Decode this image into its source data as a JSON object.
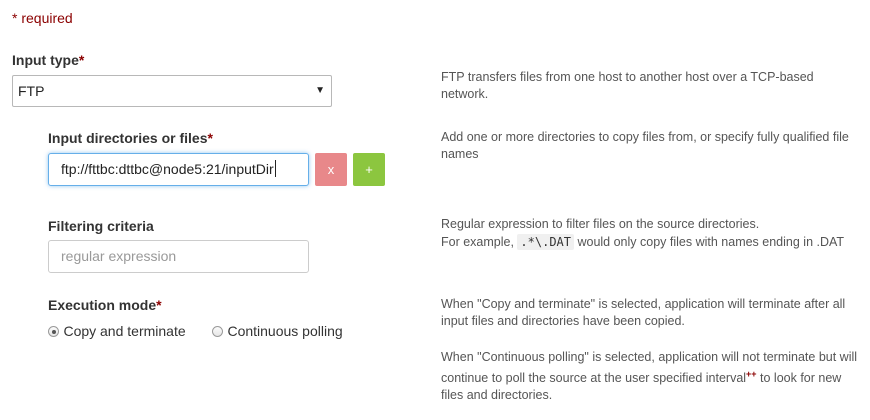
{
  "required_note": {
    "star": "*",
    "text": " required"
  },
  "input_type": {
    "label": "Input type",
    "star": "*",
    "selected": "FTP",
    "caret": "▼",
    "help": "FTP transfers files from one host to another host over a TCP-based network."
  },
  "input_dirs": {
    "label": "Input directories or files",
    "star": "*",
    "value": "ftp://fttbc:dttbc@node5:21/inputDir",
    "remove_label": "x",
    "add_label": "+",
    "help": "Add one or more directories to copy files from, or specify fully qualified file names"
  },
  "filtering": {
    "label": "Filtering criteria",
    "placeholder": "regular expression",
    "help_line1": "Regular expression to filter files on the source directories.",
    "help_prefix": "For example, ",
    "help_code": ".*\\.DAT",
    "help_suffix": " would only copy files with names ending in .DAT"
  },
  "execution_mode": {
    "label": "Execution mode",
    "star": "*",
    "options": [
      {
        "label": "Copy and terminate",
        "checked": true
      },
      {
        "label": "Continuous polling",
        "checked": false
      }
    ],
    "help1": "When \"Copy and terminate\" is selected, application will terminate after all input files and directories have been copied.",
    "help2_a": "When \"Continuous polling\" is selected, application will not terminate but will continue to poll the source at the user specified interval",
    "help2_sup": "++",
    "help2_b": " to look for new files and directories."
  }
}
